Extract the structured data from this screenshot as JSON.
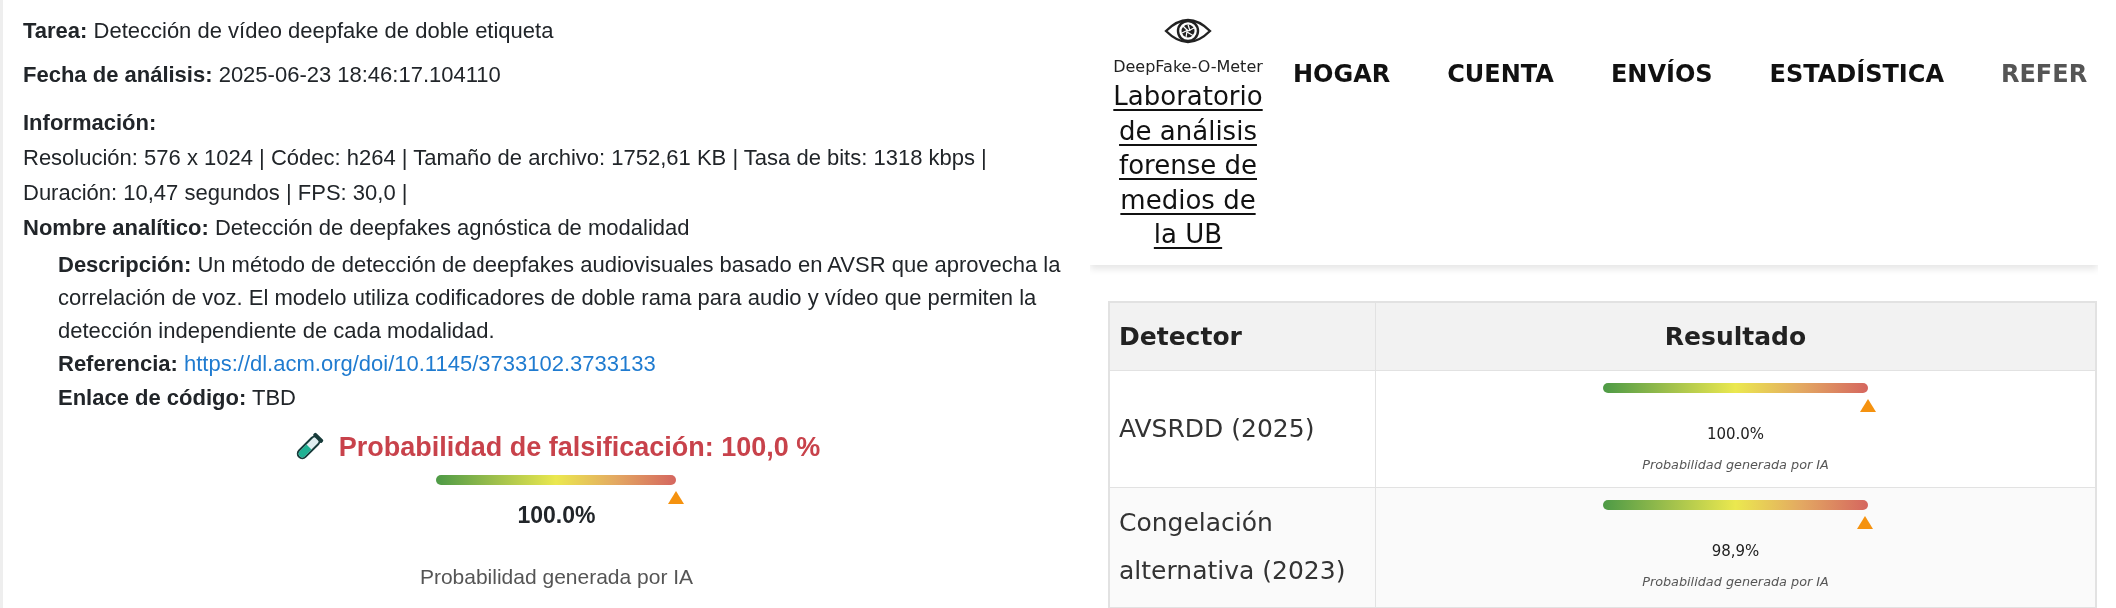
{
  "analysis": {
    "task": {
      "label": "Tarea:",
      "value": "Detección de vídeo deepfake de doble etiqueta"
    },
    "date": {
      "label": "Fecha de análisis:",
      "value": "2025-06-23 18:46:17.104110"
    },
    "info": {
      "label": "Información:",
      "lines": [
        "Resolución: 576 x 1024 | Códec: h264 | Tamaño de archivo: 1752,61 KB | Tasa de bits: 1318 kbps |",
        "Duración: 10,47 segundos | FPS: 30,0 |"
      ]
    },
    "model": {
      "label": "Nombre analítico:",
      "value": "Detección de deepfakes agnóstica de modalidad",
      "details": [
        {
          "kind": "text",
          "label": "Descripción:",
          "value": "Un método de detección de deepfakes audiovisuales basado en AVSR que aprovecha la correlación de voz. El modelo utiliza codificadores de doble rama para audio y vídeo que permiten la detección independiente de cada modalidad."
        },
        {
          "kind": "link",
          "label": "Referencia:",
          "value": "https://dl.acm.org/doi/10.1145/3733102.3733133"
        },
        {
          "kind": "text",
          "label": "Enlace de código:",
          "value": "TBD"
        }
      ]
    },
    "result": {
      "title": "Probabilidad de falsificación: 100,0 %",
      "level": 1.0,
      "reading": "100.0%",
      "caption": "Probabilidad generada por IA"
    }
  },
  "site_header": {
    "logo_text": "DeepFake-O-Meter",
    "lab_link": "Laboratorio de análisis forense de medios de la UB",
    "nav": [
      {
        "label": "HOGAR",
        "dimmed": false
      },
      {
        "label": "CUENTA",
        "dimmed": false
      },
      {
        "label": "ENVÍOS",
        "dimmed": false
      },
      {
        "label": "ESTADÍSTICA",
        "dimmed": false
      },
      {
        "label": "REFER",
        "dimmed": true
      }
    ]
  },
  "results_table": {
    "columns": [
      "Detector",
      "Resultado"
    ],
    "rows": [
      {
        "detector": "AVSRDD (2025)",
        "level": 1.0,
        "reading": "100.0%",
        "caption": "Probabilidad generada por IA"
      },
      {
        "detector": "Congelación alternativa (2023)",
        "level": 0.989,
        "reading": "98,9%",
        "caption": "Probabilidad generada por IA"
      }
    ]
  }
}
